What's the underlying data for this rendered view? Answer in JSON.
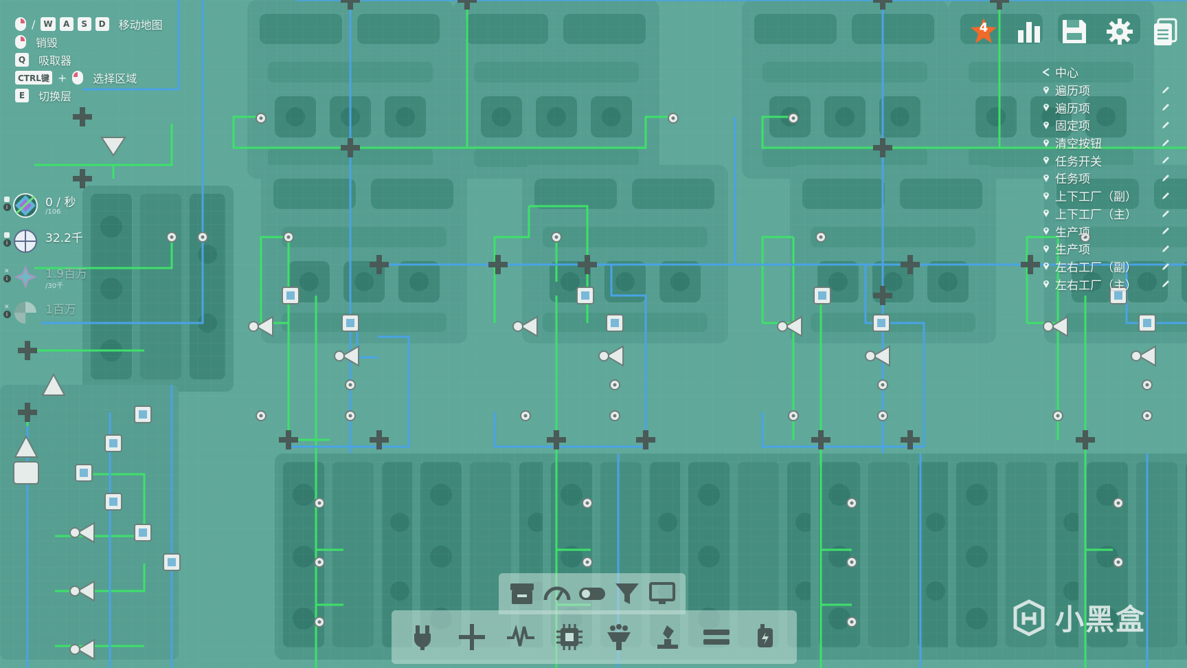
{
  "controls": {
    "move_sep": "/",
    "move_keys": [
      "W",
      "A",
      "S",
      "D"
    ],
    "move_label": "移动地图",
    "destroy_label": "销毁",
    "pipette_key": "Q",
    "pipette_label": "吸取器",
    "ctrl_key": "CTRL键",
    "plus": "+",
    "select_label": "选择区域",
    "layer_key": "E",
    "layer_label": "切换层"
  },
  "stats": [
    {
      "value": "0 / 秒",
      "sub": "/106",
      "icon": "shape-goal-icon",
      "dim": false
    },
    {
      "value": "32.2千",
      "sub": "",
      "icon": "circle-shape-icon",
      "dim": false
    },
    {
      "value": "1.9百万",
      "sub": "/30千",
      "icon": "star-shape-icon",
      "dim": true
    },
    {
      "value": "1百万",
      "sub": "",
      "icon": "half-circle-shape-icon",
      "dim": true
    }
  ],
  "toolbar": {
    "badge_count": "4",
    "colors": {
      "badge": "#f06a2a",
      "icon": "#f4f7f6"
    }
  },
  "waypoints": {
    "center_label": "中心",
    "items": [
      "遍历项",
      "遍历项",
      "固定项",
      "清空按钮",
      "任务开关",
      "任务项",
      "上下工厂（副）",
      "上下工厂（主）",
      "生产项",
      "生产项",
      "左右工厂（副）",
      "左右工厂（主）"
    ]
  },
  "palette": {
    "top": [
      "display-storage-icon",
      "gauge-icon",
      "toggle-switch-icon",
      "filter-icon",
      "monitor-icon"
    ],
    "bottom": [
      "wire-connector-icon",
      "wire-cross-icon",
      "signal-wave-icon",
      "chip-icon",
      "virtual-processor-icon",
      "analyzer-icon",
      "equals-gate-icon",
      "power-plug-icon"
    ]
  },
  "watermark": {
    "text": "小黑盒"
  },
  "colors": {
    "background": "#5fa89a",
    "wire_green": "#3fe06a",
    "wire_blue": "#4aa3e6",
    "building": "#4f9688"
  }
}
